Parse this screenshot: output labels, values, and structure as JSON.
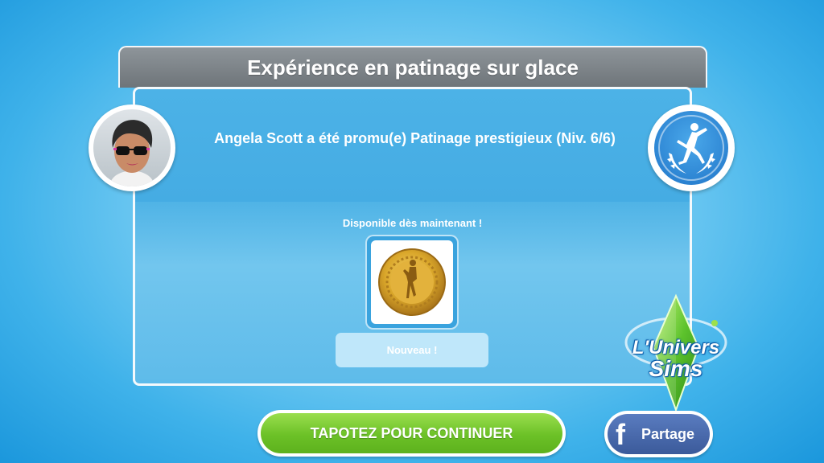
{
  "header": {
    "title": "Expérience en patinage sur glace"
  },
  "headline": "Angela Scott a été promu(e) Patinage prestigieux (Niv. 6/6)",
  "reward": {
    "available_label": "Disponible dès maintenant !",
    "new_label": "Nouveau !"
  },
  "buttons": {
    "continue_label": "TAPOTEZ POUR CONTINUER",
    "share_label": "Partage",
    "share_glyph": "f"
  },
  "logo": {
    "line1": "L'Univers",
    "line2": "Sims"
  },
  "icons": {
    "avatar": "sim-avatar-icon",
    "badge": "ice-skating-hobby-icon",
    "reward": "gold-skater-medal-icon",
    "logo": "plumbob-icon"
  },
  "colors": {
    "continue_green": "#6cc127",
    "facebook_blue": "#3b5a9a",
    "header_gray": "#7d8489",
    "medal_gold": "#d9a62a"
  }
}
